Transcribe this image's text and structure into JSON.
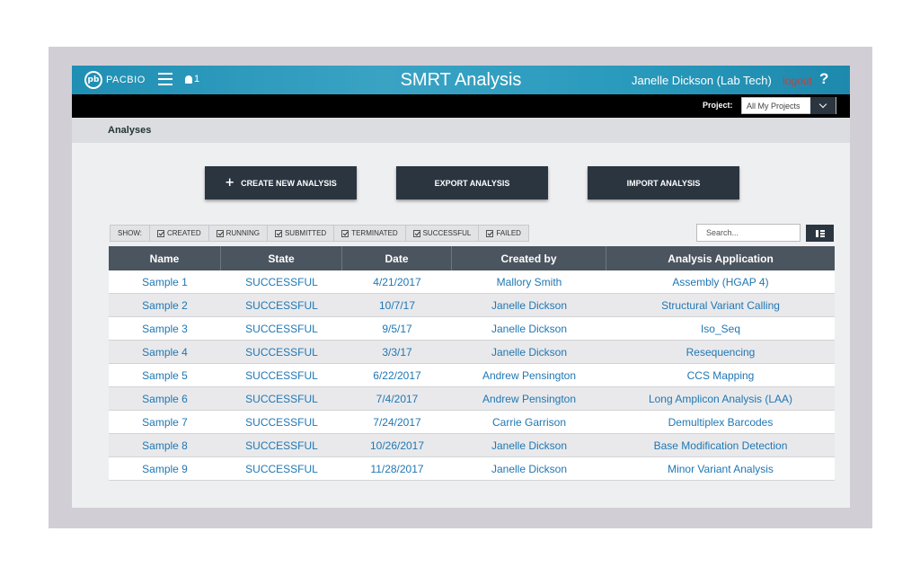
{
  "header": {
    "logo_mark": "pb",
    "logo_text": "PACBIO",
    "notification_count": "1",
    "title": "SMRT Analysis",
    "user": "Janelle Dickson (Lab Tech)",
    "logout": "logout",
    "help": "?"
  },
  "project": {
    "label": "Project:",
    "value": "All My Projects"
  },
  "page": {
    "title": "Analyses"
  },
  "actions": {
    "create_label": "CREATE NEW ANALYSIS",
    "export_label": "EXPORT ANALYSIS",
    "import_label": "IMPORT ANALYSIS"
  },
  "filters": {
    "show_label": "SHOW:",
    "items": [
      "CREATED",
      "RUNNING",
      "SUBMITTED",
      "TERMINATED",
      "SUCCESSFUL",
      "FAILED"
    ]
  },
  "search": {
    "placeholder": "Search..."
  },
  "table": {
    "columns": [
      "Name",
      "State",
      "Date",
      "Created by",
      "Analysis Application"
    ],
    "rows": [
      [
        "Sample 1",
        "SUCCESSFUL",
        "4/21/2017",
        "Mallory Smith",
        "Assembly (HGAP 4)"
      ],
      [
        "Sample 2",
        "SUCCESSFUL",
        "10/7/17",
        "Janelle Dickson",
        "Structural Variant Calling"
      ],
      [
        "Sample 3",
        "SUCCESSFUL",
        "9/5/17",
        "Janelle Dickson",
        "Iso_Seq"
      ],
      [
        "Sample 4",
        "SUCCESSFUL",
        "3/3/17",
        "Janelle Dickson",
        "Resequencing"
      ],
      [
        "Sample 5",
        "SUCCESSFUL",
        "6/22/2017",
        "Andrew Pensington",
        "CCS Mapping"
      ],
      [
        "Sample 6",
        "SUCCESSFUL",
        "7/4/2017",
        "Andrew Pensington",
        "Long Amplicon Analysis (LAA)"
      ],
      [
        "Sample 7",
        "SUCCESSFUL",
        "7/24/2017",
        "Carrie Garrison",
        "Demultiplex Barcodes"
      ],
      [
        "Sample 8",
        "SUCCESSFUL",
        "10/26/2017",
        "Janelle Dickson",
        "Base Modification Detection"
      ],
      [
        "Sample 9",
        "SUCCESSFUL",
        "11/28/2017",
        "Janelle Dickson",
        "Minor Variant Analysis"
      ]
    ]
  },
  "colors": {
    "header_teal": "#2a9bbd",
    "dark_button": "#2b3540",
    "link_blue": "#1f77b4",
    "logout_red": "#e2342c"
  }
}
